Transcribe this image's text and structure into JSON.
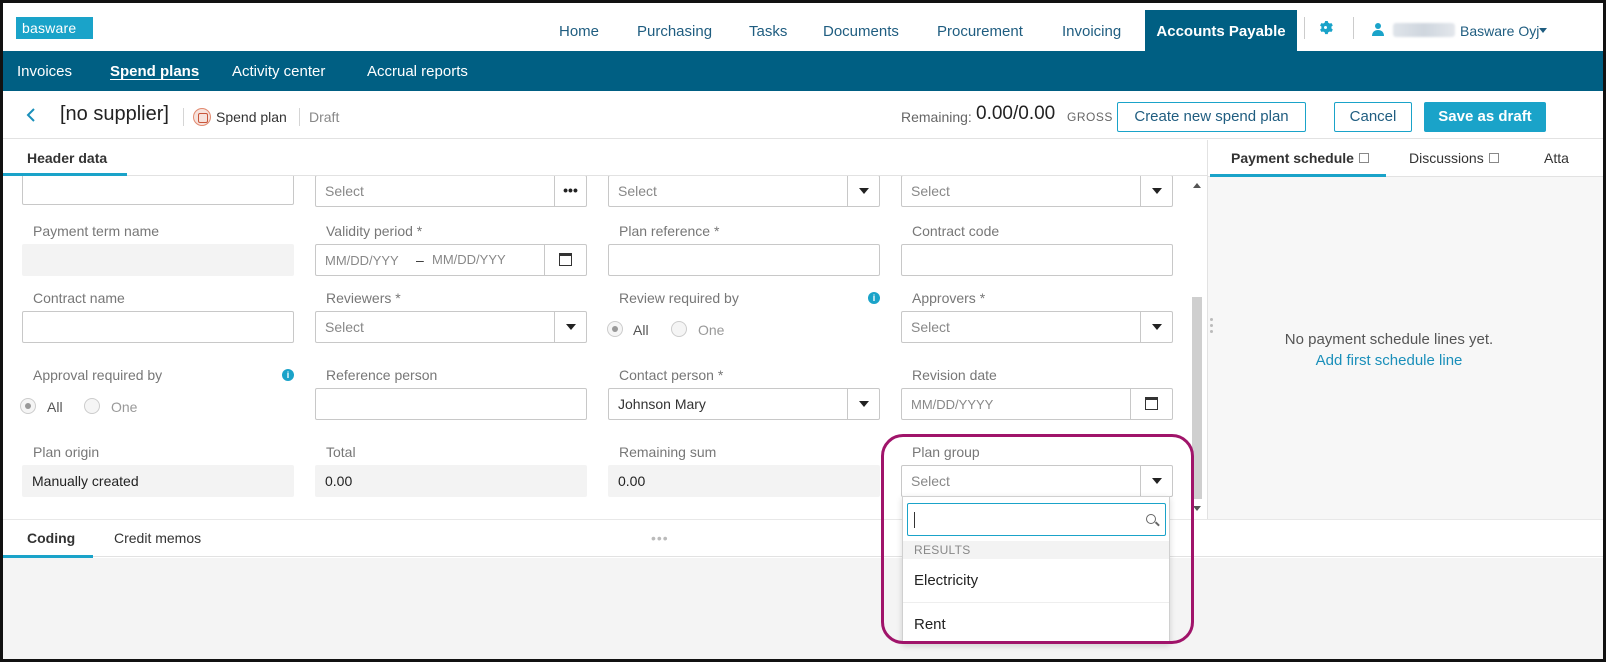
{
  "topnav": {
    "logo": "basware",
    "items": [
      "Home",
      "Purchasing",
      "Tasks",
      "Documents",
      "Procurement",
      "Invoicing",
      "Accounts Payable"
    ],
    "active": "Accounts Payable",
    "company": "Basware Oyj"
  },
  "subnav": {
    "items": [
      "Invoices",
      "Spend plans",
      "Activity center",
      "Accrual reports"
    ],
    "active": "Spend plans"
  },
  "titlebar": {
    "title": "[no supplier]",
    "doc_type": "Spend plan",
    "status": "Draft",
    "remaining_label": "Remaining:",
    "remaining_value": "0.00/0.00",
    "remaining_unit": "GROSS",
    "create_btn": "Create new spend plan",
    "cancel_btn": "Cancel",
    "save_btn": "Save as draft"
  },
  "left_tab": "Header data",
  "right_tabs": [
    "Payment schedule",
    "Discussions",
    "Atta"
  ],
  "form": {
    "row0": {
      "col2": "Select",
      "col3": "Select",
      "col4": "Select"
    },
    "payment_term_name": {
      "label": "Payment term name",
      "value": ""
    },
    "validity_period": {
      "label": "Validity period *",
      "from_placeholder": "MM/DD/YYY",
      "dash": "–",
      "to_placeholder": "MM/DD/YYY"
    },
    "plan_reference": {
      "label": "Plan reference *",
      "value": ""
    },
    "contract_code": {
      "label": "Contract code",
      "value": ""
    },
    "contract_name": {
      "label": "Contract name",
      "value": ""
    },
    "reviewers": {
      "label": "Reviewers *",
      "value": "Select"
    },
    "review_required_by": {
      "label": "Review required by",
      "opt_all": "All",
      "opt_one": "One"
    },
    "approvers": {
      "label": "Approvers *",
      "value": "Select"
    },
    "approval_required_by": {
      "label": "Approval required by",
      "opt_all": "All",
      "opt_one": "One"
    },
    "reference_person": {
      "label": "Reference person",
      "value": ""
    },
    "contact_person": {
      "label": "Contact person *",
      "value": "Johnson Mary"
    },
    "revision_date": {
      "label": "Revision date",
      "placeholder": "MM/DD/YYYY"
    },
    "plan_origin": {
      "label": "Plan origin",
      "value": "Manually created"
    },
    "total": {
      "label": "Total",
      "value": "0.00"
    },
    "remaining_sum": {
      "label": "Remaining sum",
      "value": "0.00"
    },
    "plan_group": {
      "label": "Plan group",
      "value": "Select"
    }
  },
  "right_panel": {
    "empty_msg": "No payment schedule lines yet.",
    "add_link": "Add first schedule line"
  },
  "bottom_tabs": [
    "Coding",
    "Credit memos"
  ],
  "dropdown": {
    "results_header": "RESULTS",
    "options": [
      "Electricity",
      "Rent"
    ]
  },
  "colors": {
    "brand": "#005f83",
    "accent": "#1aa3c9",
    "highlight": "#a0146a"
  }
}
